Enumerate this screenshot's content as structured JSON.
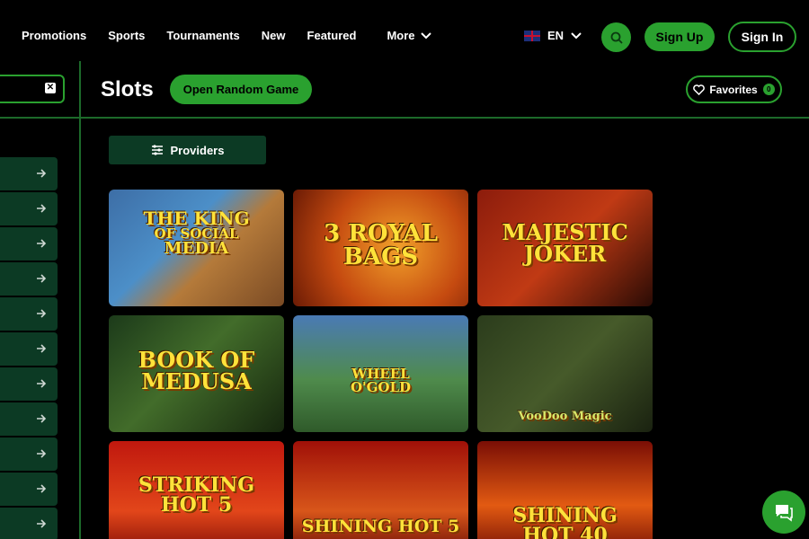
{
  "nav": {
    "items": [
      "Promotions",
      "Sports",
      "Tournaments",
      "New",
      "Featured"
    ],
    "more_label": "More"
  },
  "header": {
    "language": "EN",
    "signup_label": "Sign Up",
    "signin_label": "Sign In"
  },
  "page": {
    "title": "Slots",
    "random_label": "Open Random Game",
    "favorites_label": "Favorites",
    "favorites_count": "0",
    "providers_label": "Providers"
  },
  "sidebar": {
    "item_count": 11
  },
  "games": [
    {
      "title_lines": [
        "THE KING",
        "OF SOCIAL",
        "MEDIA"
      ]
    },
    {
      "title_lines": [
        "3 ROYAL",
        "BAGS"
      ]
    },
    {
      "title_lines": [
        "MAJESTIC",
        "JOKER"
      ]
    },
    {
      "title_lines": [
        "BOOK OF",
        "MEDUSA"
      ]
    },
    {
      "title_lines": [
        "WHEEL",
        "O'GOLD"
      ]
    },
    {
      "title_lines": [
        "VooDoo Magic"
      ]
    },
    {
      "title_lines": [
        "STRIKING",
        "HOT 5"
      ]
    },
    {
      "title_lines": [
        "SHINING HOT 5"
      ]
    },
    {
      "title_lines": [
        "SHINING",
        "HOT 40"
      ]
    }
  ],
  "colors": {
    "accent": "#2aa12f",
    "panel": "#0c3a24",
    "background": "#000000"
  }
}
